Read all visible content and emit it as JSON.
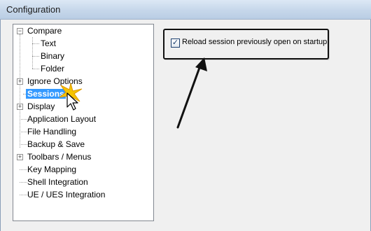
{
  "window": {
    "title": "Configuration"
  },
  "tree": {
    "items": [
      {
        "label": "Compare",
        "expander": "−"
      },
      {
        "label": "Text"
      },
      {
        "label": "Binary"
      },
      {
        "label": "Folder"
      },
      {
        "label": "Ignore Options",
        "expander": "+"
      },
      {
        "label": "Sessions",
        "selected": true
      },
      {
        "label": "Display",
        "expander": "+"
      },
      {
        "label": "Application Layout"
      },
      {
        "label": "File Handling"
      },
      {
        "label": "Backup & Save"
      },
      {
        "label": "Toolbars / Menus",
        "expander": "+"
      },
      {
        "label": "Key Mapping"
      },
      {
        "label": "Shell Integration"
      },
      {
        "label": "UE / UES Integration"
      }
    ]
  },
  "options": {
    "reload_session": {
      "label": "Reload session previously open on startup",
      "checked": true,
      "checkmark": "✓"
    }
  },
  "colors": {
    "selection": "#3399ff",
    "sparkle": "#f5c400",
    "annotation_border": "#111111"
  },
  "icons": [
    "collapse-icon",
    "expand-icon",
    "pointer-cursor-icon",
    "sparkle-icon",
    "arrow-annotation-icon"
  ]
}
